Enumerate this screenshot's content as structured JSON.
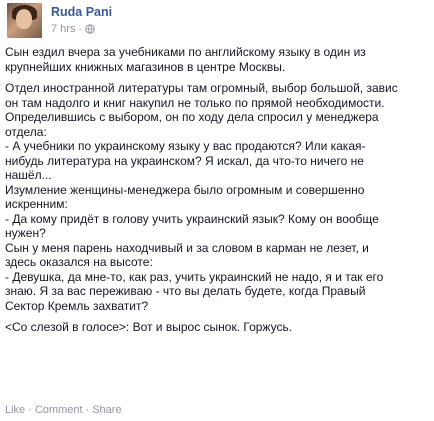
{
  "post": {
    "author": "Ruda Pani",
    "time": "7 hrs",
    "icon": "globe-icon",
    "paragraphs": [
      "Сын ездил вчера за учебниками по английскому языку в один из\nкрупнейших книжных магазинов в центре Москвы.",
      "Отдел иностранной литературы там огромный, выбор большой, завис\nон там надолго и книг накупил не только по прямой необходимости.\nОпределившись с выбором, он по ходу дела спросил у менеджера\nотдела:\n- А учебники по украинскому языку у вас продаются? Или какая-\nнибудь литература на украинском? Я искал, да что-то ничего не\nнашёл...\nИзумление женщины-менеджера было огромным и совершенно\nискренним:\n- Да кому придёт в голову учить украинский язык? Кому он вообще\nнужен?\nСын у меня парень находчивый и за словом в карман не лезет, и\nздесь оказался на высоте:\n- Девушка, да мне-то, как раз, учить украинский не надо, я и так его\nзнаю. Я за вас переживаю - что вы делать будете, когда Правый\nСектор Кремль захватит?",
      "<Со слезой в голосе>: Вот и вырос сынок. Горжусь."
    ]
  },
  "actions": {
    "like": "Like",
    "comment": "Comment",
    "share": "Share",
    "separator": "·"
  }
}
